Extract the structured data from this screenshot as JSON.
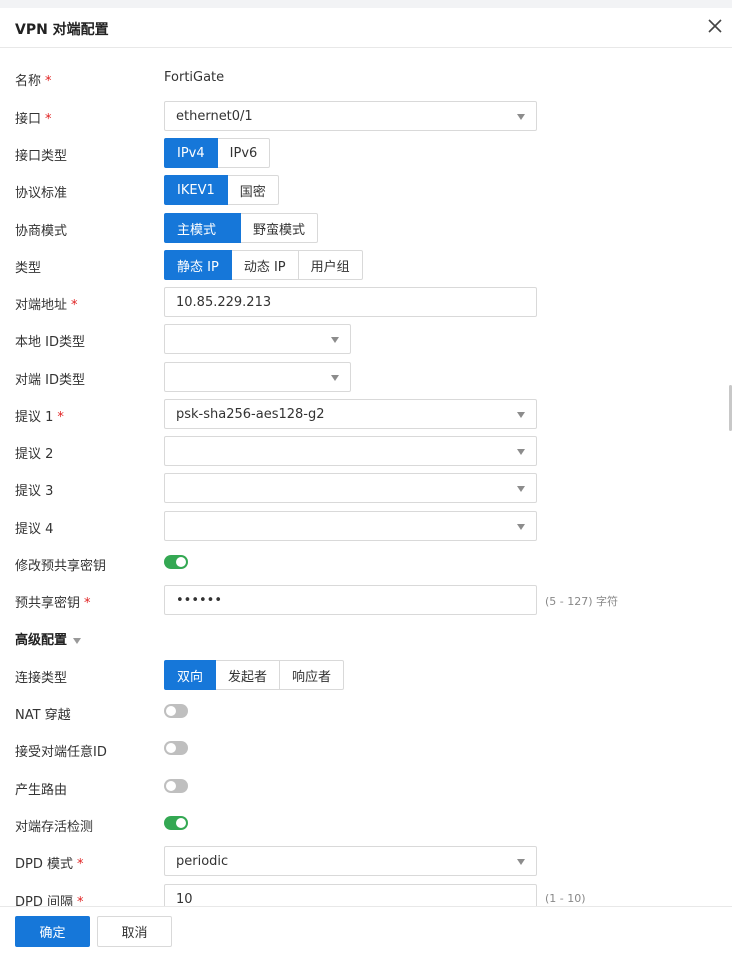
{
  "dialog": {
    "title": "VPN 对端配置",
    "close_icon": "close-icon"
  },
  "required_mark": "*",
  "fields": {
    "name": {
      "label": "名称",
      "value": "FortiGate"
    },
    "interface": {
      "label": "接口",
      "value": "ethernet0/1"
    },
    "interface_type": {
      "label": "接口类型",
      "options": [
        "IPv4",
        "IPv6"
      ],
      "selected": "IPv4"
    },
    "protocol": {
      "label": "协议标准",
      "options": [
        "IKEV1",
        "国密"
      ],
      "selected": "IKEV1"
    },
    "negotiation_mode": {
      "label": "协商模式",
      "options": [
        "主模式",
        "野蛮模式"
      ],
      "selected": "主模式"
    },
    "type": {
      "label": "类型",
      "options": [
        "静态 IP",
        "动态 IP",
        "用户组"
      ],
      "selected": "静态 IP"
    },
    "peer_address": {
      "label": "对端地址",
      "value": "10.85.229.213"
    },
    "local_id_type": {
      "label": "本地 ID类型",
      "value": ""
    },
    "peer_id_type": {
      "label": "对端 ID类型",
      "value": ""
    },
    "proposal1": {
      "label": "提议 1",
      "value": "psk-sha256-aes128-g2"
    },
    "proposal2": {
      "label": "提议 2",
      "value": ""
    },
    "proposal3": {
      "label": "提议 3",
      "value": ""
    },
    "proposal4": {
      "label": "提议 4",
      "value": ""
    },
    "modify_psk": {
      "label": "修改预共享密钥",
      "on": true
    },
    "psk": {
      "label": "预共享密钥",
      "value": "••••••",
      "hint": "(5 - 127) 字符"
    }
  },
  "advanced": {
    "title": "高级配置",
    "connection_type": {
      "label": "连接类型",
      "options": [
        "双向",
        "发起者",
        "响应者"
      ],
      "selected": "双向"
    },
    "nat_traversal": {
      "label": "NAT 穿越",
      "on": false
    },
    "accept_any_peer_id": {
      "label": "接受对端任意ID",
      "on": false
    },
    "generate_route": {
      "label": "产生路由",
      "on": false
    },
    "dpd": {
      "label": "对端存活检测",
      "on": true
    },
    "dpd_mode": {
      "label": "DPD 模式",
      "value": "periodic"
    },
    "dpd_interval": {
      "label": "DPD 间隔",
      "value": "10",
      "hint": "(1 - 10)"
    }
  },
  "footer": {
    "confirm_label": "确定",
    "cancel_label": "取消"
  },
  "colors": {
    "accent": "#1677d9",
    "toggle_on": "#34a853",
    "toggle_off": "#bfbfbf",
    "required": "#e02020"
  }
}
